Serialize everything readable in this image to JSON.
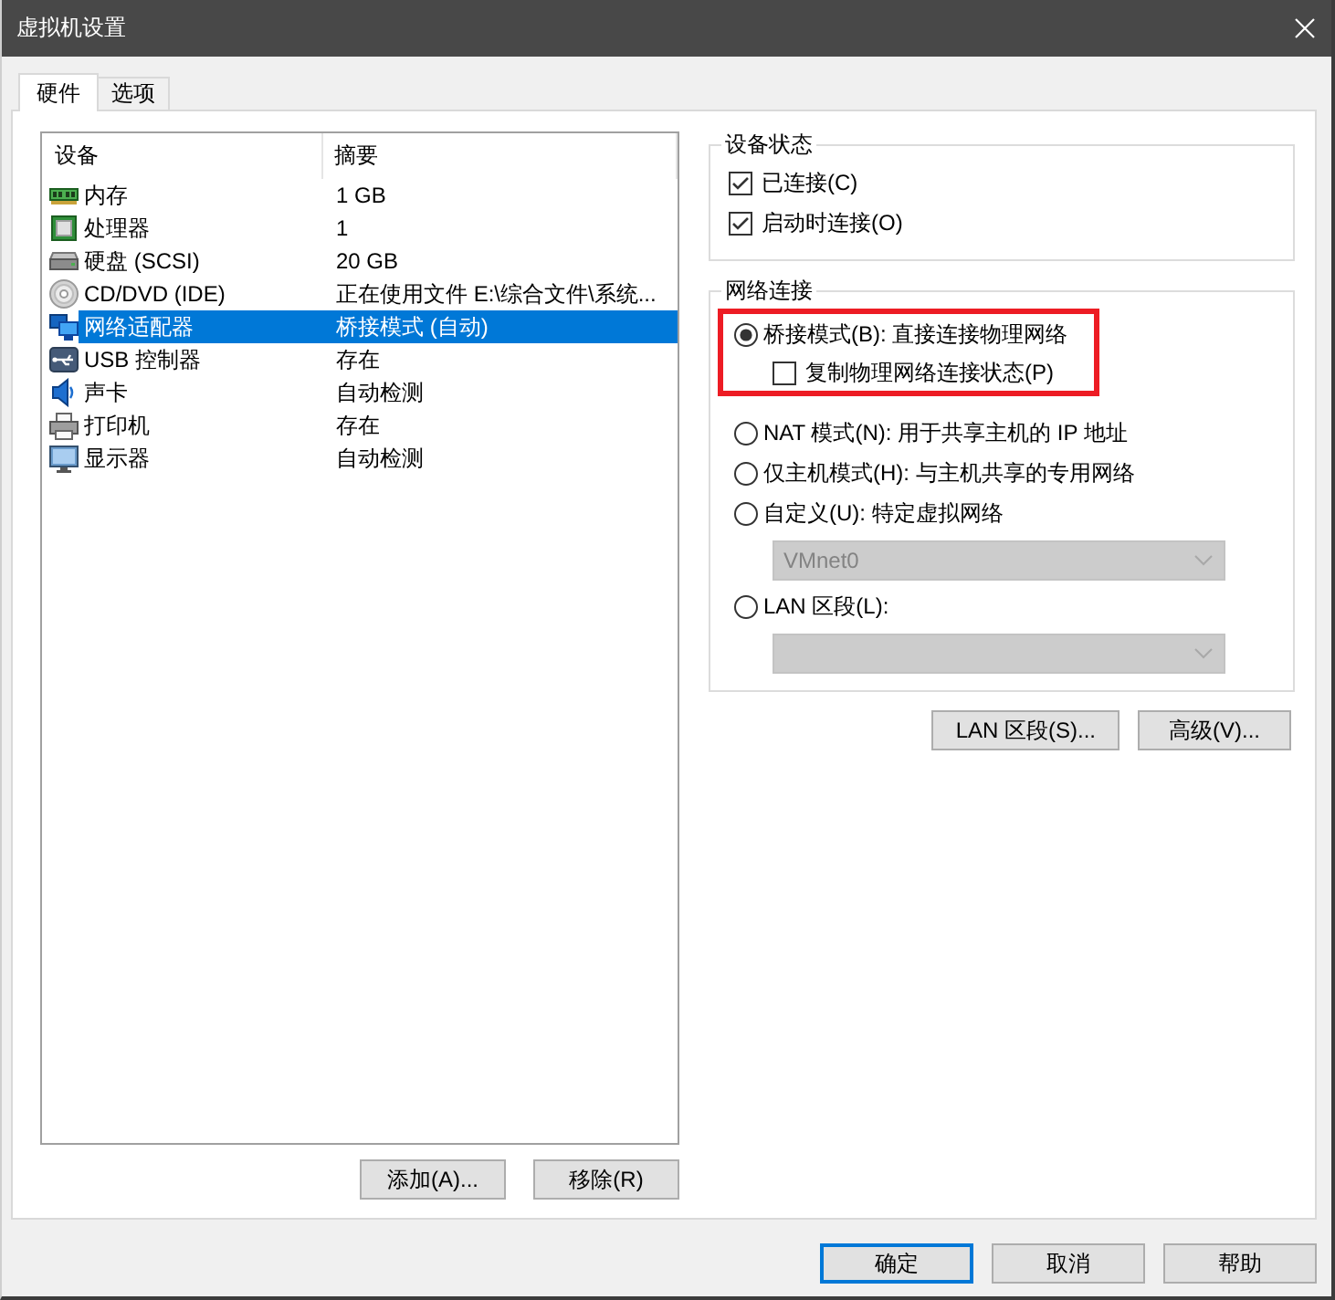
{
  "window": {
    "title": "虚拟机设置"
  },
  "tabs": [
    {
      "label": "硬件",
      "selected": true
    },
    {
      "label": "选项",
      "selected": false
    }
  ],
  "device_list": {
    "columns": [
      "设备",
      "摘要"
    ],
    "rows": [
      {
        "kind": "memory",
        "device": "内存",
        "summary": "1 GB",
        "selected": false
      },
      {
        "kind": "processor",
        "device": "处理器",
        "summary": "1",
        "selected": false
      },
      {
        "kind": "disk",
        "device": "硬盘 (SCSI)",
        "summary": "20 GB",
        "selected": false
      },
      {
        "kind": "cd",
        "device": "CD/DVD (IDE)",
        "summary": "正在使用文件 E:\\综合文件\\系统...",
        "selected": false
      },
      {
        "kind": "network",
        "device": "网络适配器",
        "summary": "桥接模式 (自动)",
        "selected": true
      },
      {
        "kind": "usb",
        "device": "USB 控制器",
        "summary": "存在",
        "selected": false
      },
      {
        "kind": "sound",
        "device": "声卡",
        "summary": "自动检测",
        "selected": false
      },
      {
        "kind": "printer",
        "device": "打印机",
        "summary": "存在",
        "selected": false
      },
      {
        "kind": "display",
        "device": "显示器",
        "summary": "自动检测",
        "selected": false
      }
    ]
  },
  "device_buttons": [
    "添加(A)...",
    "移除(R)"
  ],
  "device_status": {
    "title": "设备状态",
    "checkboxes": [
      {
        "label": "已连接(C)",
        "checked": true
      },
      {
        "label": "启动时连接(O)",
        "checked": true
      }
    ]
  },
  "network_connection": {
    "title": "网络连接",
    "options": [
      {
        "label": "桥接模式(B): 直接连接物理网络",
        "selected": true,
        "highlighted": true,
        "sub_option": {
          "label": "复制物理网络连接状态(P)",
          "checked": false
        }
      },
      {
        "label": "NAT 模式(N): 用于共享主机的 IP 地址",
        "selected": false,
        "highlighted": false
      },
      {
        "label": "仅主机模式(H): 与主机共享的专用网络",
        "selected": false,
        "highlighted": false
      },
      {
        "label": "自定义(U): 特定虚拟网络",
        "selected": false,
        "highlighted": false,
        "dropdown": {
          "value": "VMnet0",
          "disabled": true
        }
      },
      {
        "label": "LAN 区段(L):",
        "selected": false,
        "highlighted": false,
        "dropdown": {
          "disabled": true
        }
      }
    ]
  },
  "network_buttons": [
    "LAN 区段(S)...",
    "高级(V)..."
  ],
  "dialog_buttons": [
    {
      "label": "确定",
      "default": true
    },
    {
      "label": "取消",
      "default": false
    },
    {
      "label": "帮助",
      "default": false
    }
  ]
}
